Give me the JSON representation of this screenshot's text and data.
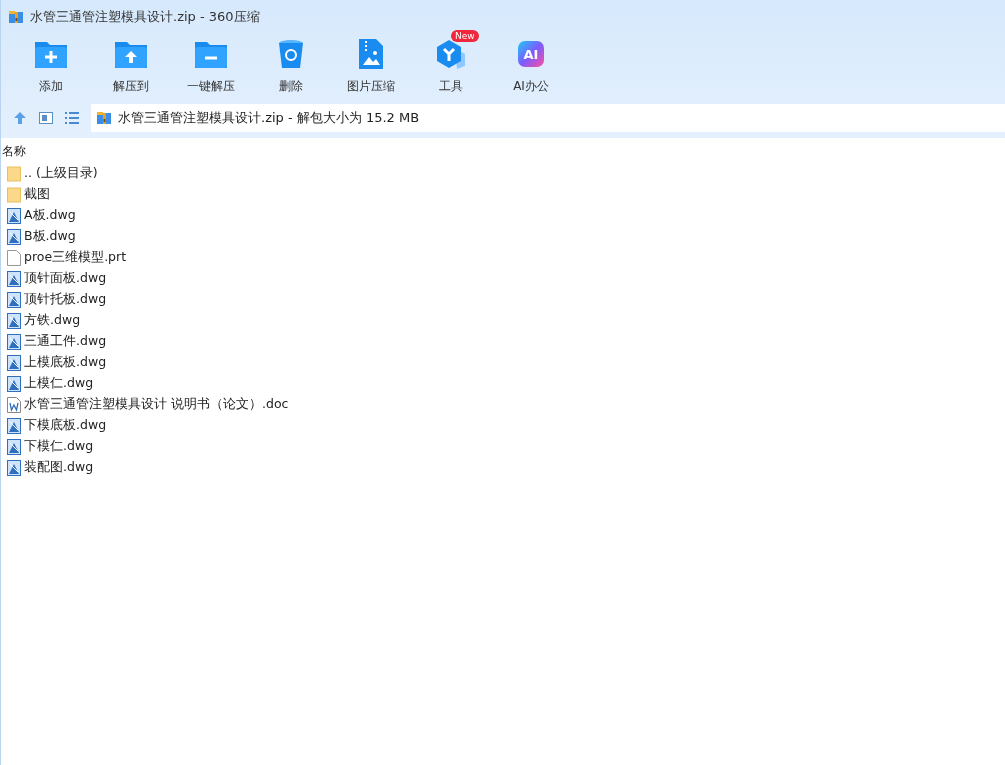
{
  "window": {
    "title": "水管三通管注塑模具设计.zip - 360压缩"
  },
  "toolbar": [
    {
      "label": "添加",
      "kind": "add"
    },
    {
      "label": "解压到",
      "kind": "extract"
    },
    {
      "label": "一键解压",
      "kind": "quick"
    },
    {
      "label": "删除",
      "kind": "delete"
    },
    {
      "label": "图片压缩",
      "kind": "image"
    },
    {
      "label": "工具",
      "kind": "tools",
      "badge": "New"
    },
    {
      "label": "AI办公",
      "kind": "ai",
      "icon_text": "AI"
    }
  ],
  "address_bar": {
    "path": "水管三通管注塑模具设计.zip - 解包大小为 15.2 MB"
  },
  "file_list": {
    "column_1": "名称",
    "rows": [
      {
        "name": ".. (上级目录)",
        "kind": "folder"
      },
      {
        "name": "截图",
        "kind": "folder"
      },
      {
        "name": "A板.dwg",
        "kind": "dwg"
      },
      {
        "name": "B板.dwg",
        "kind": "dwg"
      },
      {
        "name": "proe三维模型.prt",
        "kind": "blank"
      },
      {
        "name": "顶针面板.dwg",
        "kind": "dwg"
      },
      {
        "name": "顶针托板.dwg",
        "kind": "dwg"
      },
      {
        "name": "方铁.dwg",
        "kind": "dwg"
      },
      {
        "name": "三通工件.dwg",
        "kind": "dwg"
      },
      {
        "name": "上模底板.dwg",
        "kind": "dwg"
      },
      {
        "name": "上模仁.dwg",
        "kind": "dwg"
      },
      {
        "name": "水管三通管注塑模具设计 说明书（论文）.doc",
        "kind": "doc"
      },
      {
        "name": "下模底板.dwg",
        "kind": "dwg"
      },
      {
        "name": "下模仁.dwg",
        "kind": "dwg"
      },
      {
        "name": "装配图.dwg",
        "kind": "dwg"
      }
    ]
  }
}
